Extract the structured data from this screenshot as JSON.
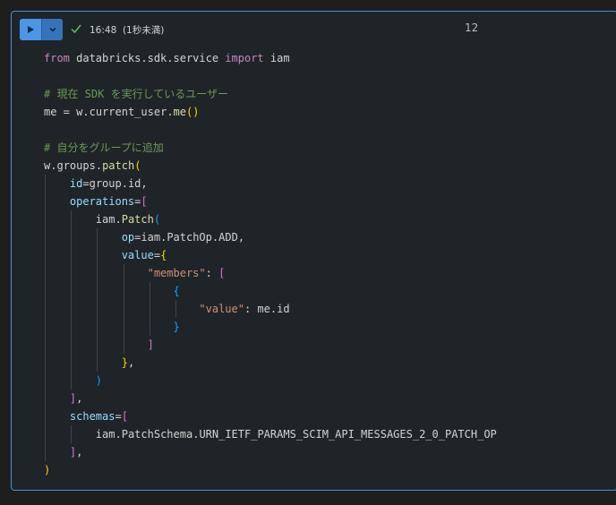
{
  "toolbar": {
    "run_icon": "play-icon",
    "menu_icon": "chevron-down-icon",
    "status_icon": "check-icon",
    "status_color": "#4ec94e",
    "accent_color": "#4a8ed6",
    "time": "16:48",
    "duration": "(1秒未満)",
    "execution_count": "12"
  },
  "code": {
    "lines": [
      [
        [
          "from",
          "kw"
        ],
        [
          " databricks.sdk.service ",
          "pl"
        ],
        [
          "import",
          "kw"
        ],
        [
          " iam",
          "pl"
        ]
      ],
      [],
      [
        [
          "# 現在 SDK を実行しているユーザー",
          "cm"
        ]
      ],
      [
        [
          "me",
          "pl"
        ],
        [
          " = ",
          "pl"
        ],
        [
          "w",
          "pl"
        ],
        [
          ".",
          "pl"
        ],
        [
          "current_user",
          "pl"
        ],
        [
          ".",
          "pl"
        ],
        [
          "me",
          "fn"
        ],
        [
          "()",
          "b1"
        ]
      ],
      [],
      [
        [
          "# 自分をグループに追加",
          "cm"
        ]
      ],
      [
        [
          "w",
          "pl"
        ],
        [
          ".",
          "pl"
        ],
        [
          "groups",
          "pl"
        ],
        [
          ".",
          "pl"
        ],
        [
          "patch",
          "fn"
        ],
        [
          "(",
          "b1"
        ]
      ],
      [
        [
          "    ",
          "pl"
        ],
        [
          "id",
          "var"
        ],
        [
          "=",
          "pl"
        ],
        [
          "group",
          "pl"
        ],
        [
          ".",
          "pl"
        ],
        [
          "id",
          "pl"
        ],
        [
          ",",
          "pl"
        ]
      ],
      [
        [
          "    ",
          "pl"
        ],
        [
          "operations",
          "var"
        ],
        [
          "=",
          "pl"
        ],
        [
          "[",
          "b2"
        ]
      ],
      [
        [
          "        ",
          "pl"
        ],
        [
          "iam",
          "pl"
        ],
        [
          ".",
          "pl"
        ],
        [
          "Patch",
          "fn"
        ],
        [
          "(",
          "b3"
        ]
      ],
      [
        [
          "            ",
          "pl"
        ],
        [
          "op",
          "var"
        ],
        [
          "=",
          "pl"
        ],
        [
          "iam",
          "pl"
        ],
        [
          ".",
          "pl"
        ],
        [
          "PatchOp",
          "pl"
        ],
        [
          ".",
          "pl"
        ],
        [
          "ADD",
          "pl"
        ],
        [
          ",",
          "pl"
        ]
      ],
      [
        [
          "            ",
          "pl"
        ],
        [
          "value",
          "var"
        ],
        [
          "=",
          "pl"
        ],
        [
          "{",
          "b1"
        ]
      ],
      [
        [
          "                ",
          "pl"
        ],
        [
          "\"members\"",
          "str"
        ],
        [
          ": ",
          "pl"
        ],
        [
          "[",
          "b2"
        ]
      ],
      [
        [
          "                    ",
          "pl"
        ],
        [
          "{",
          "b3"
        ]
      ],
      [
        [
          "                        ",
          "pl"
        ],
        [
          "\"value\"",
          "str"
        ],
        [
          ": ",
          "pl"
        ],
        [
          "me",
          "pl"
        ],
        [
          ".",
          "pl"
        ],
        [
          "id",
          "pl"
        ]
      ],
      [
        [
          "                    ",
          "pl"
        ],
        [
          "}",
          "b3"
        ]
      ],
      [
        [
          "                ",
          "pl"
        ],
        [
          "]",
          "b2"
        ]
      ],
      [
        [
          "            ",
          "pl"
        ],
        [
          "}",
          "b1"
        ],
        [
          ",",
          "pl"
        ]
      ],
      [
        [
          "        ",
          "pl"
        ],
        [
          ")",
          "b3"
        ]
      ],
      [
        [
          "    ",
          "pl"
        ],
        [
          "]",
          "b2"
        ],
        [
          ",",
          "pl"
        ]
      ],
      [
        [
          "    ",
          "pl"
        ],
        [
          "schemas",
          "var"
        ],
        [
          "=",
          "pl"
        ],
        [
          "[",
          "b2"
        ]
      ],
      [
        [
          "        ",
          "pl"
        ],
        [
          "iam",
          "pl"
        ],
        [
          ".",
          "pl"
        ],
        [
          "PatchSchema",
          "pl"
        ],
        [
          ".",
          "pl"
        ],
        [
          "URN_IETF_PARAMS_SCIM_API_MESSAGES_2_0_PATCH_OP",
          "pl"
        ]
      ],
      [
        [
          "    ",
          "pl"
        ],
        [
          "]",
          "b2"
        ],
        [
          ",",
          "pl"
        ]
      ],
      [
        [
          ")",
          "b1"
        ]
      ]
    ]
  }
}
